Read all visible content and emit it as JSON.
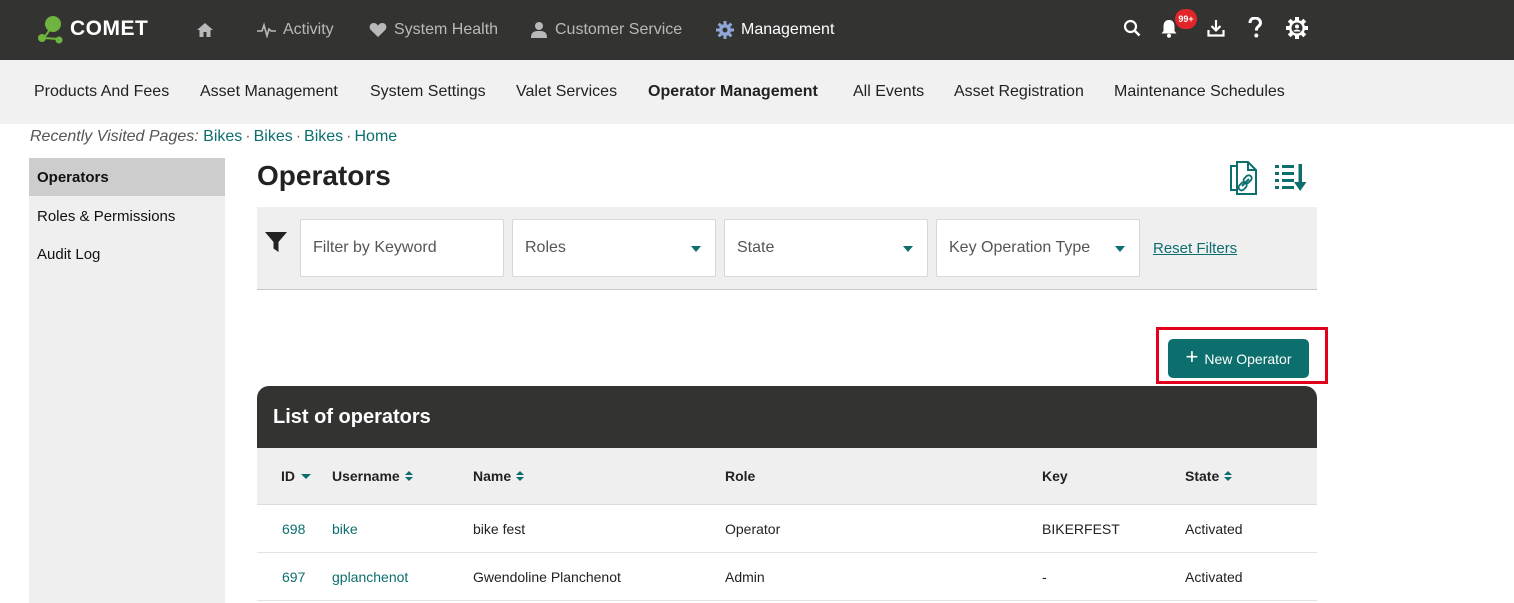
{
  "app": {
    "logo_text": "COMET"
  },
  "topnav": {
    "items": [
      {
        "label": "",
        "icon": "home-icon"
      },
      {
        "label": "Activity",
        "icon": "activity-icon"
      },
      {
        "label": "System Health",
        "icon": "heart-icon"
      },
      {
        "label": "Customer Service",
        "icon": "user-icon"
      },
      {
        "label": "Management",
        "icon": "gear-icon",
        "active": true
      }
    ],
    "notification_badge": "99+"
  },
  "subnav": {
    "items": [
      {
        "label": "Products And Fees"
      },
      {
        "label": "Asset Management"
      },
      {
        "label": "System Settings"
      },
      {
        "label": "Valet Services"
      },
      {
        "label": "Operator Management",
        "active": true
      },
      {
        "label": "All Events"
      },
      {
        "label": "Asset Registration"
      },
      {
        "label": "Maintenance Schedules"
      }
    ]
  },
  "breadcrumb": {
    "label": "Recently Visited Pages:",
    "links": [
      "Bikes",
      "Bikes",
      "Bikes",
      "Home"
    ],
    "separator": "·"
  },
  "sidebar": {
    "items": [
      {
        "label": "Operators",
        "active": true
      },
      {
        "label": "Roles & Permissions"
      },
      {
        "label": "Audit Log"
      }
    ]
  },
  "main": {
    "title": "Operators",
    "filters": {
      "keyword_placeholder": "Filter by Keyword",
      "roles": "Roles",
      "state": "State",
      "key_operation_type": "Key Operation Type",
      "reset_label": "Reset Filters"
    },
    "new_button_label": "New Operator",
    "table": {
      "title": "List of operators",
      "columns": [
        "ID",
        "Username",
        "Name",
        "Role",
        "Key",
        "State"
      ],
      "rows": [
        {
          "id": "698",
          "username": "bike",
          "name": "bike fest",
          "role": "Operator",
          "key": "BIKERFEST",
          "state": "Activated"
        },
        {
          "id": "697",
          "username": "gplanchenot",
          "name": "Gwendoline Planchenot",
          "role": "Admin",
          "key": "-",
          "state": "Activated"
        }
      ]
    }
  },
  "colors": {
    "accent": "#0d6e6e",
    "topbar": "#333331",
    "highlight": "#e3001b",
    "badge": "#e0262b"
  }
}
